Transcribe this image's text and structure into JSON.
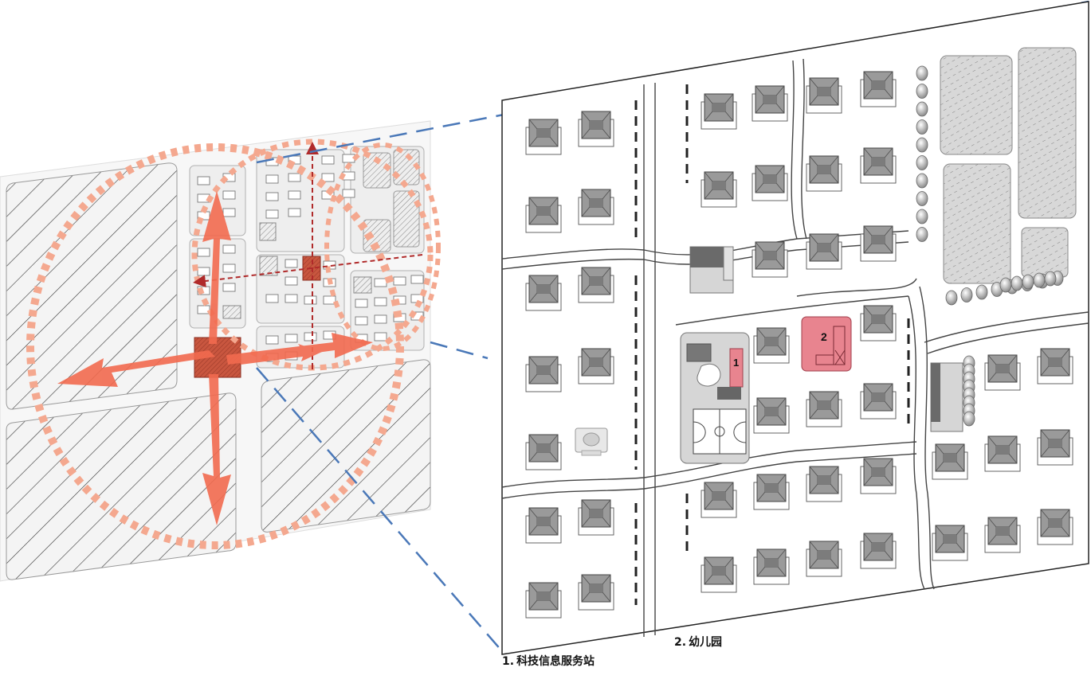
{
  "labels": {
    "tech_station": {
      "number": "1.",
      "name": "科技信息服务站"
    },
    "kindergarten": {
      "number": "2.",
      "name": "幼儿园"
    }
  },
  "markers": {
    "tech_station": "1",
    "kindergarten": "2"
  },
  "colors": {
    "arrow": "#f26a4f",
    "ring": "#f4a88f",
    "axis": "#b02a2a",
    "leader": "#4a78b8",
    "highlight": "#e8848f",
    "roof": "#9a9a9a",
    "roof_dark": "#7c7c7c",
    "block_fill": "#f0f0f0",
    "building_fill": "#ffffff",
    "hatch": "#333333"
  },
  "icons": [
    "arrow-icon",
    "house-icon",
    "tree-icon",
    "basketball-court-icon"
  ]
}
